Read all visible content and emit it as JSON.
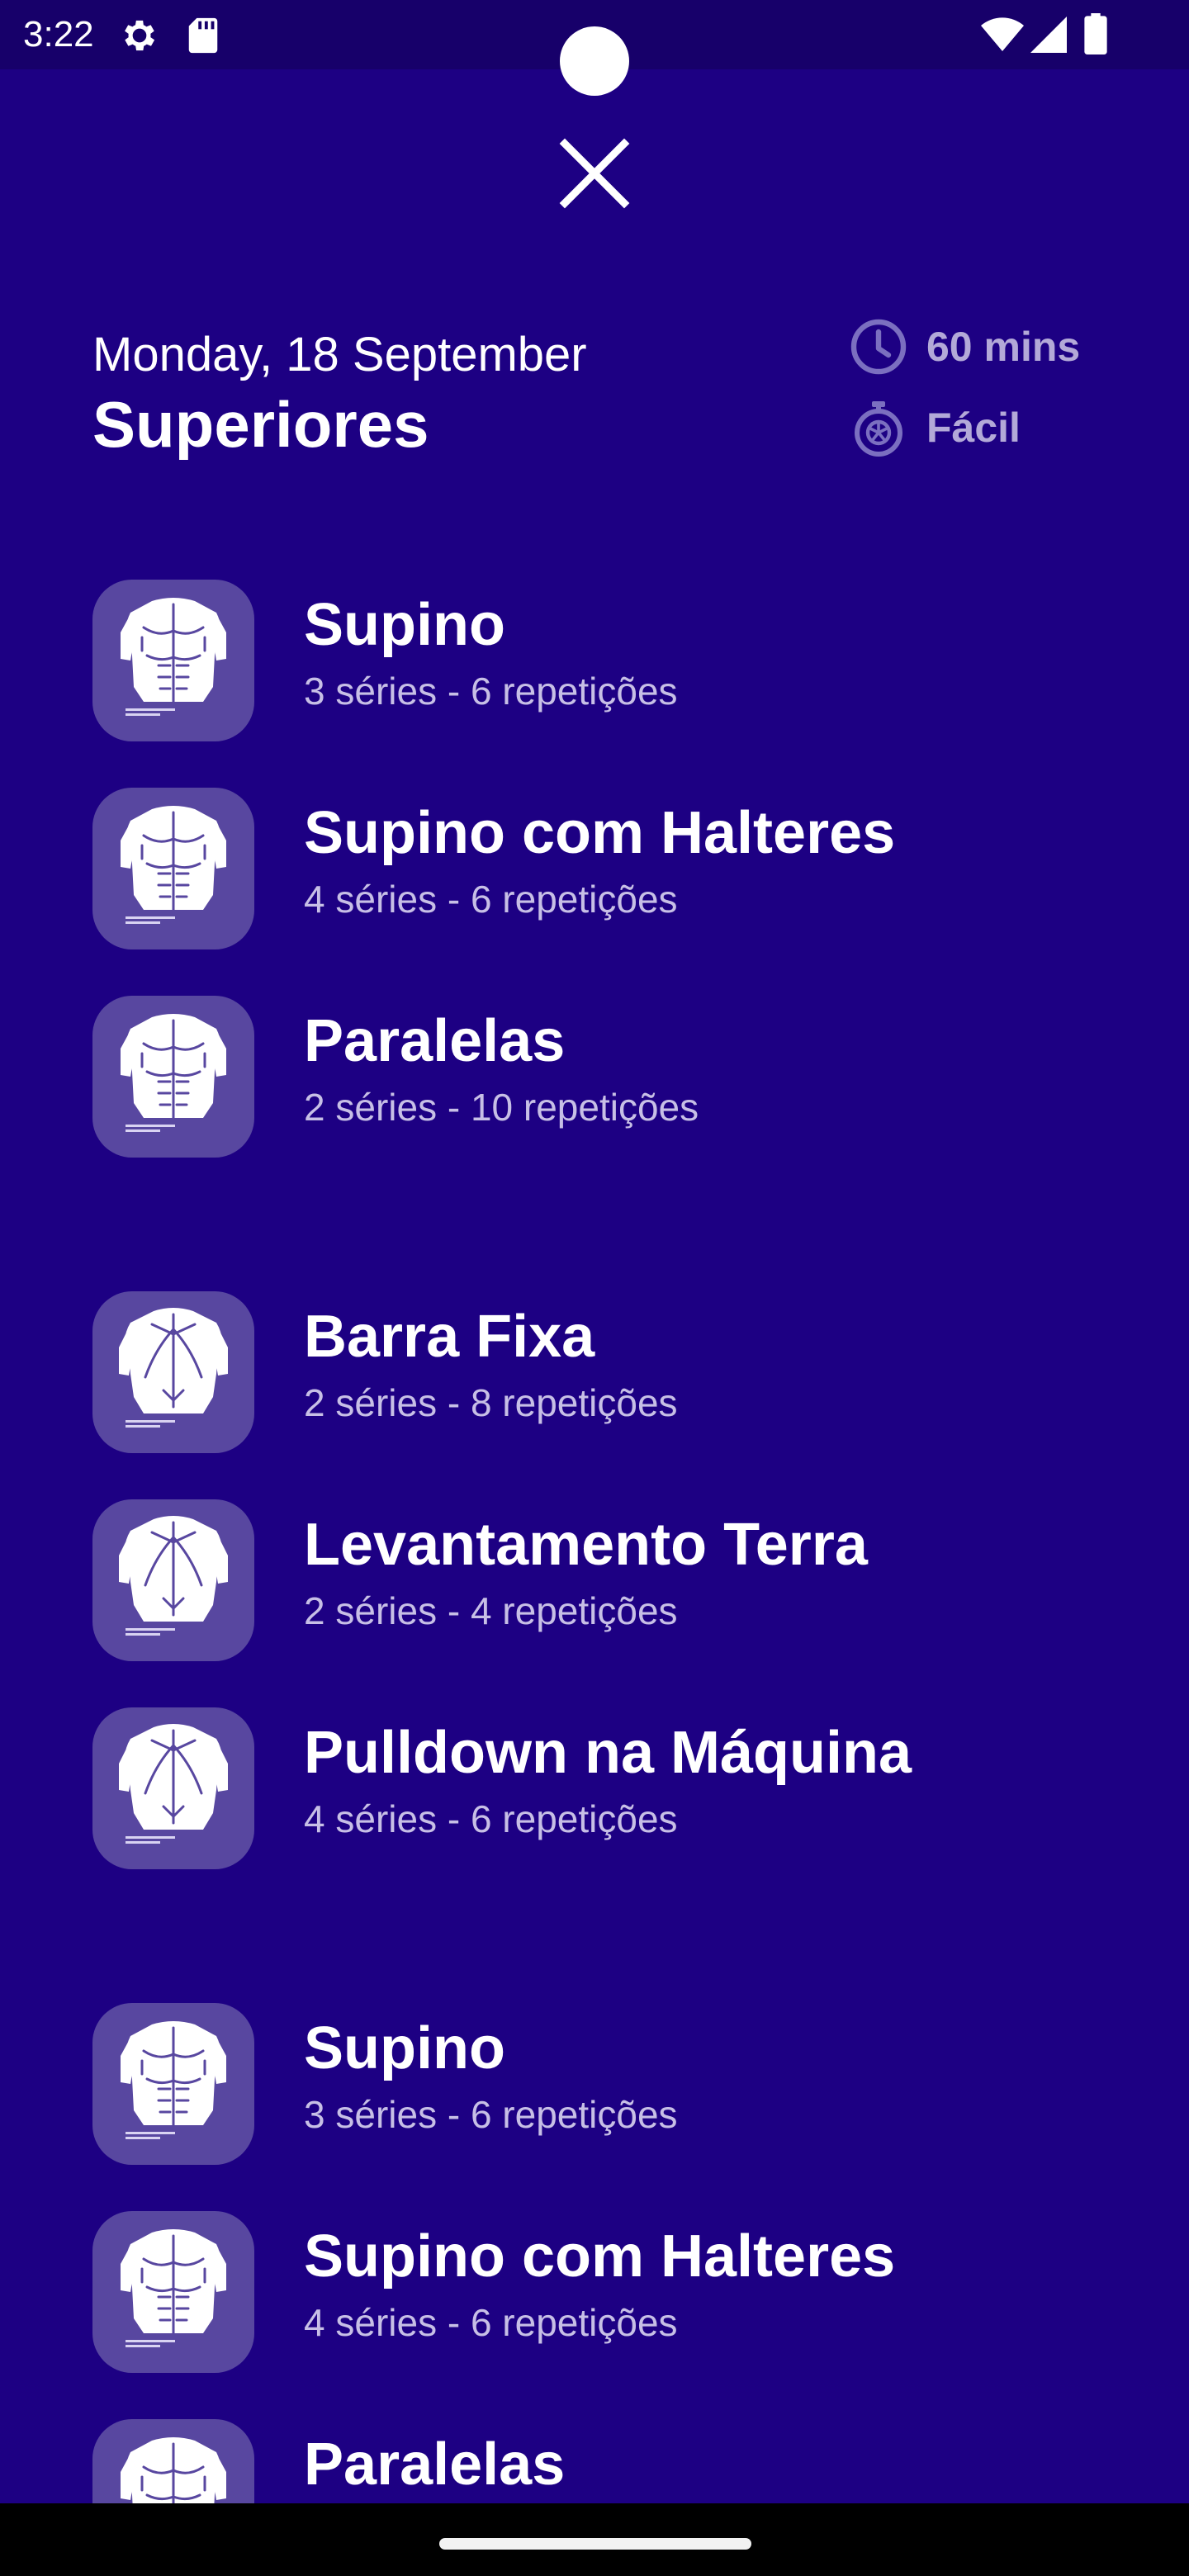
{
  "status_bar": {
    "time": "3:22",
    "icons": [
      "gear-icon",
      "sd-card-icon",
      "wifi-icon",
      "signal-icon",
      "battery-icon"
    ]
  },
  "close_button": {
    "icon": "close-icon"
  },
  "header": {
    "date": "Monday, 18 September",
    "title": "Superiores",
    "duration": "60 mins",
    "difficulty": "Fácil"
  },
  "colors": {
    "background": "#1d0083",
    "status_bar": "#17006a",
    "thumb_background": "#5847a0",
    "meta_text": "#b3a9d8",
    "detail_text": "#c7bfe6"
  },
  "exercises": [
    {
      "name": "Supino",
      "detail": "3 séries - 6 repetições",
      "icon": "chest-muscle-icon"
    },
    {
      "name": "Supino com Halteres",
      "detail": "4 séries - 6 repetições",
      "icon": "chest-muscle-icon"
    },
    {
      "name": "Paralelas",
      "detail": "2 séries - 10 repetições",
      "icon": "chest-muscle-icon"
    },
    {
      "name": "Barra Fixa",
      "detail": "2 séries - 8 repetições",
      "icon": "back-muscle-icon"
    },
    {
      "name": "Levantamento Terra",
      "detail": "2 séries - 4 repetições",
      "icon": "back-muscle-icon"
    },
    {
      "name": "Pulldown na Máquina",
      "detail": "4 séries - 6 repetições",
      "icon": "back-muscle-icon"
    },
    {
      "name": "Supino",
      "detail": "3 séries - 6 repetições",
      "icon": "chest-muscle-icon"
    },
    {
      "name": "Supino com Halteres",
      "detail": "4 séries - 6 repetições",
      "icon": "chest-muscle-icon"
    },
    {
      "name": "Paralelas",
      "detail": "",
      "icon": "chest-muscle-icon"
    }
  ]
}
